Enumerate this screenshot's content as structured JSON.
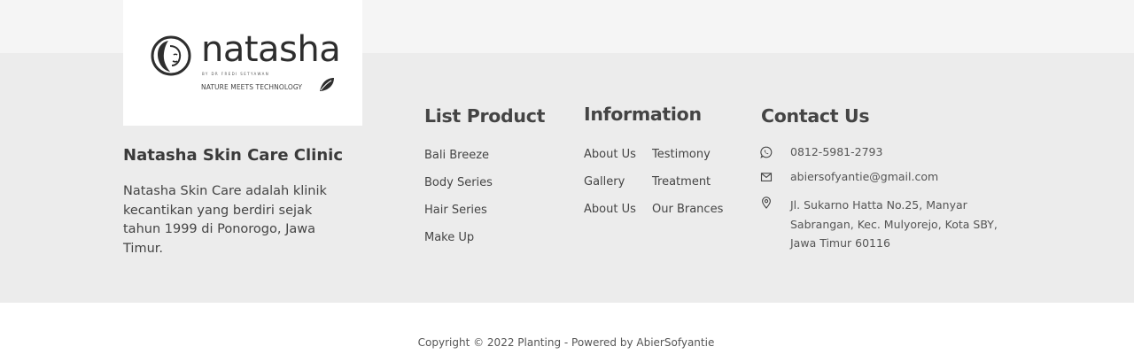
{
  "brand": {
    "logo_word": "natasha",
    "logo_byline": "BY DR FREDI SETYAWAN",
    "logo_tagline": "NATURE MEETS TECHNOLOGY",
    "name": "Natasha Skin Care Clinic",
    "description": "Natasha Skin Care adalah klinik kecantikan yang berdiri sejak tahun 1999 di Ponorogo, Jawa Timur."
  },
  "list_product": {
    "title": "List Product",
    "items": [
      "Bali Breeze",
      "Body Series",
      "Hair Series",
      "Make Up"
    ]
  },
  "information": {
    "title": "Information",
    "col1": [
      "About Us",
      "Gallery",
      "About Us"
    ],
    "col2": [
      "Testimony",
      "Treatment",
      "Our Brances"
    ]
  },
  "contact": {
    "title": "Contact Us",
    "phone": "0812-5981-2793",
    "email": "abiersofyantie@gmail.com",
    "address": "Jl. Sukarno Hatta No.25, Manyar Sabrangan, Kec. Mulyorejo, Kota SBY, Jawa Timur 60116",
    "icons": [
      "whatsapp-icon",
      "mail-icon",
      "location-pin-icon"
    ]
  },
  "footer": {
    "copyright": "Copyright © 2022 Planting  - Powered by AbierSofyantie"
  },
  "colors": {
    "top_band": "#f5f5f5",
    "footer_bg": "#ececec",
    "bottom_bg": "#ffffff",
    "text": "#3a3a3a"
  }
}
